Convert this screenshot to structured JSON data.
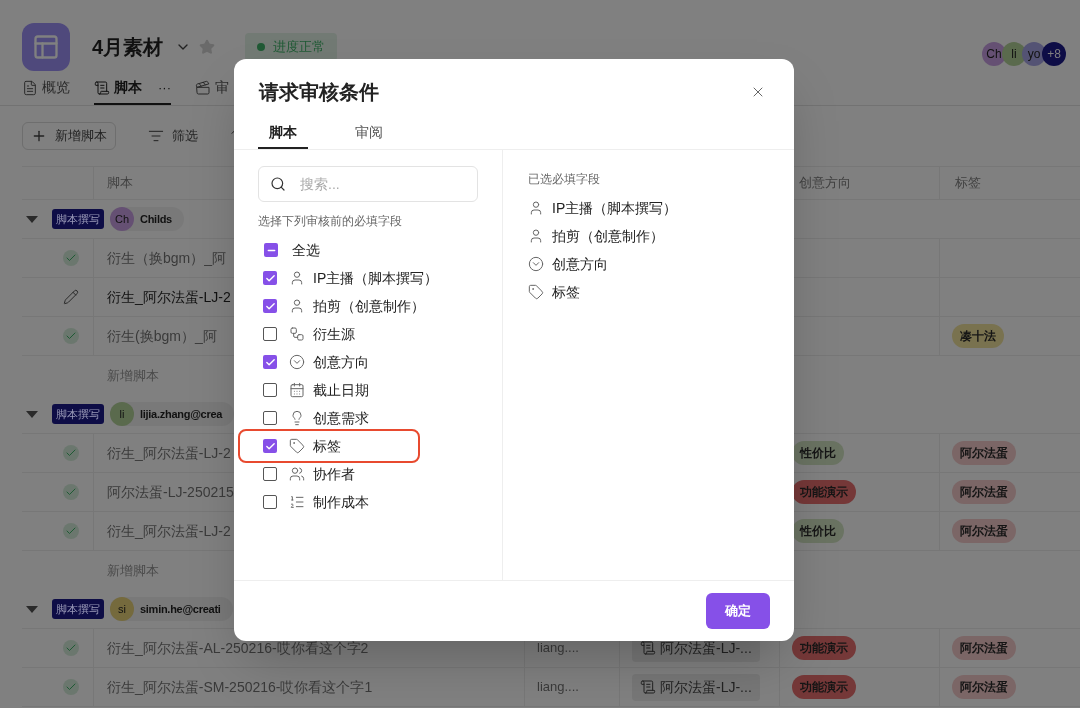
{
  "project": {
    "title": "4月素材",
    "status": {
      "label": "进度正常",
      "color": "#205a35"
    },
    "starred": false
  },
  "members": [
    {
      "initials": "Ch",
      "color": "#655073"
    },
    {
      "initials": "li",
      "color": "#5a6a4d"
    },
    {
      "initials": "yo",
      "color": "#545374"
    },
    {
      "initials": "+8",
      "color": "#0e0d46"
    }
  ],
  "tabs": [
    {
      "label": "概览",
      "kind": "overview",
      "selected": false
    },
    {
      "label": "脚本",
      "kind": "script",
      "selected": true,
      "more": "···"
    },
    {
      "label": "审",
      "kind": "review",
      "selected": false
    }
  ],
  "toolbar": {
    "add_button": "新增脚本",
    "filter_button": "筛选"
  },
  "table": {
    "columns": [
      "脚本",
      "创意方向",
      "标签"
    ],
    "groups": [
      {
        "stage": "脚本撰写",
        "user": {
          "initials": "Ch",
          "name": "Childs",
          "color": "#655073"
        },
        "add_label": "新增脚本",
        "rows": [
          {
            "kind": "done",
            "title": "衍生（换bgm）_阿"
          },
          {
            "kind": "editing",
            "title": "衍生_阿尔法蛋-LJ-2"
          },
          {
            "kind": "done",
            "title": "衍生(换bgm）_阿",
            "tag": {
              "label": "凑十法",
              "color": "#79724f"
            }
          }
        ]
      },
      {
        "stage": "脚本撰写",
        "user": {
          "initials": "li",
          "name": "lijia.zhang@crea",
          "color": "#5a6a4d"
        },
        "add_label": "新增脚本",
        "rows": [
          {
            "kind": "done",
            "title": "衍生_阿尔法蛋-LJ-2",
            "direction": {
              "label": "性价比",
              "color": "#6a7362"
            },
            "tag": {
              "label": "阿尔法蛋",
              "color": "#7b6666"
            }
          },
          {
            "kind": "done",
            "title": "阿尔法蛋-LJ-250215",
            "direction": {
              "label": "功能演示",
              "color": "#753838"
            },
            "tag": {
              "label": "阿尔法蛋",
              "color": "#7b6666"
            }
          },
          {
            "kind": "done",
            "title": "衍生_阿尔法蛋-LJ-2",
            "direction": {
              "label": "性价比",
              "color": "#6a7362"
            },
            "tag": {
              "label": "阿尔法蛋",
              "color": "#7b6666"
            }
          }
        ]
      },
      {
        "stage": "脚本撰写",
        "user": {
          "initials": "si",
          "name": "simin.he@creati",
          "color": "#756a3d"
        },
        "rows": [
          {
            "kind": "done",
            "title": "衍生_阿尔法蛋-AL-250216-哎你看这个字2",
            "owner": "liang....",
            "source": "阿尔法蛋-LJ-...",
            "direction": {
              "label": "功能演示",
              "color": "#753838"
            },
            "tag": {
              "label": "阿尔法蛋",
              "color": "#7b6666"
            }
          },
          {
            "kind": "done",
            "title": "衍生_阿尔法蛋-SM-250216-哎你看这个字1",
            "owner": "liang....",
            "source": "阿尔法蛋-LJ-...",
            "direction": {
              "label": "功能演示",
              "color": "#753838"
            },
            "tag": {
              "label": "阿尔法蛋",
              "color": "#7b6666"
            }
          }
        ]
      }
    ]
  },
  "modal": {
    "title": "请求审核条件",
    "tabs": [
      {
        "label": "脚本",
        "selected": true
      },
      {
        "label": "审阅",
        "selected": false
      }
    ],
    "search": {
      "placeholder": "搜索..."
    },
    "hint": "选择下列审核前的必填字段",
    "select_all": {
      "label": "全选",
      "checked": true,
      "indeterminate": true
    },
    "fields": [
      {
        "label": "IP主播（脚本撰写）",
        "kind": "person",
        "checked": true,
        "highlighted": false
      },
      {
        "label": "拍剪（创意制作）",
        "kind": "person",
        "checked": true,
        "highlighted": false
      },
      {
        "label": "衍生源",
        "kind": "source",
        "checked": false,
        "highlighted": false
      },
      {
        "label": "创意方向",
        "kind": "select",
        "checked": true,
        "highlighted": false
      },
      {
        "label": "截止日期",
        "kind": "date",
        "checked": false,
        "highlighted": false
      },
      {
        "label": "创意需求",
        "kind": "idea",
        "checked": false,
        "highlighted": false
      },
      {
        "label": "标签",
        "kind": "tag",
        "checked": true,
        "highlighted": true
      },
      {
        "label": "协作者",
        "kind": "people",
        "checked": false,
        "highlighted": false
      },
      {
        "label": "制作成本",
        "kind": "number",
        "checked": false,
        "highlighted": false
      }
    ],
    "selected_title": "已选必填字段",
    "selected_fields": [
      {
        "label": "IP主播（脚本撰写）",
        "kind": "person"
      },
      {
        "label": "拍剪（创意制作）",
        "kind": "person"
      },
      {
        "label": "创意方向",
        "kind": "select"
      },
      {
        "label": "标签",
        "kind": "tag"
      }
    ],
    "confirm": "确定"
  }
}
